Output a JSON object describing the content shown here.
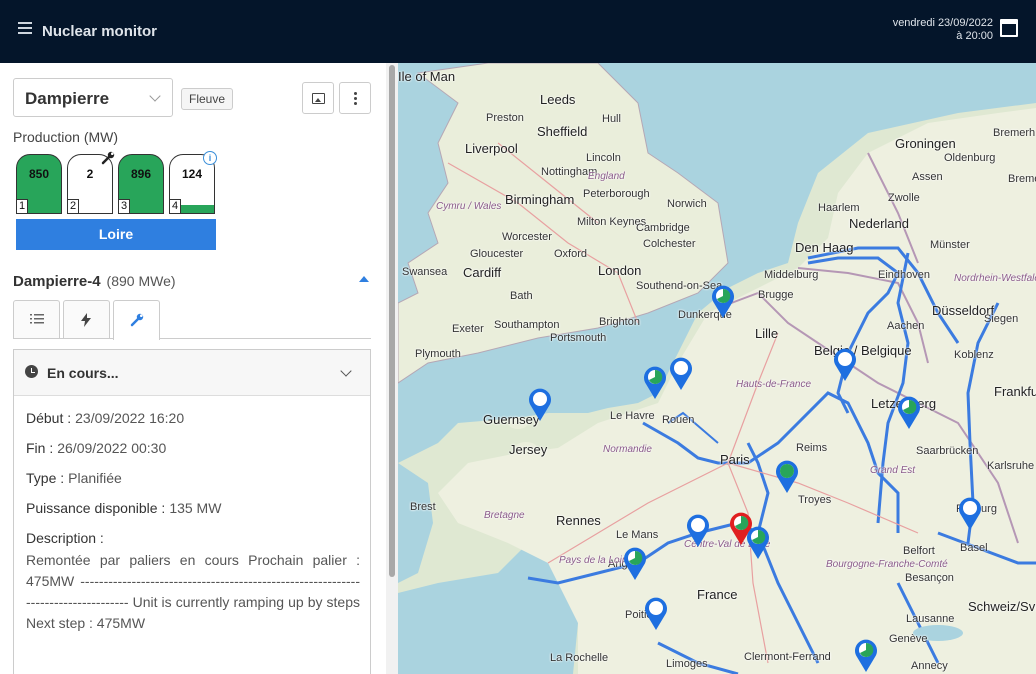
{
  "header": {
    "title": "Nuclear monitor",
    "date_line": "vendredi 23/09/2022",
    "time_line": "à 20:00"
  },
  "plant_selector": {
    "value": "Dampierre"
  },
  "plant_tag": "Fleuve",
  "production": {
    "label": "Production (MW)",
    "units": [
      {
        "number": "1",
        "value": "850",
        "fill_fraction": 1.0,
        "status": "running"
      },
      {
        "number": "2",
        "value": "2",
        "fill_fraction": 0.0,
        "status": "maintenance"
      },
      {
        "number": "3",
        "value": "896",
        "fill_fraction": 1.0,
        "status": "running"
      },
      {
        "number": "4",
        "value": "124",
        "fill_fraction": 0.14,
        "status": "info"
      }
    ],
    "river_button": "Loire"
  },
  "unit_detail": {
    "name": "Dampierre-4",
    "capacity": "(890 MWe)",
    "tabs": [
      "list",
      "power",
      "maintenance"
    ],
    "active_tab": "maintenance"
  },
  "event_card": {
    "title": "En cours...",
    "start_label": "Début :",
    "start_value": "23/09/2022 16:20",
    "end_label": "Fin :",
    "end_value": "26/09/2022 00:30",
    "type_label": "Type :",
    "type_value": "Planifiée",
    "power_label": "Puissance disponible :",
    "power_value": "135 MW",
    "description_label": "Description :",
    "description": "Remontée par paliers en cours Prochain palier : 475MW ---------------------------------------------------------------------------------- Unit is currently ramping up by steps Next step : 475MW"
  },
  "map": {
    "cities": [
      "Leeds",
      "Preston",
      "Hull",
      "Sheffield",
      "Liverpool",
      "Lincoln",
      "Nottingham",
      "England",
      "Peterborough",
      "Cymru / Wales",
      "Birmingham",
      "Norwich",
      "Milton Keynes",
      "Cambridge",
      "Worcester",
      "Colchester",
      "Gloucester",
      "Oxford",
      "Swansea",
      "Cardiff",
      "London",
      "Southend-on-Sea",
      "Bath",
      "Exeter",
      "Southampton",
      "Brighton",
      "Portsmouth",
      "Plymouth",
      "Dunkerque",
      "Lille",
      "Brugge",
      "Middelburg",
      "Den Haag",
      "Haarlem",
      "Nederland",
      "Groningen",
      "Oldenburg",
      "Assen",
      "Zwolle",
      "Münster",
      "Eindhoven",
      "Düsseldorf",
      "Aachen",
      "Siegen",
      "Koblenz",
      "Nordrhein-Westfalen",
      "Belgie / Belgique",
      "Letzebuerg",
      "Frankfurt",
      "Saarbrücken",
      "Karlsruhe",
      "Le Havre",
      "Rouen",
      "Paris",
      "Reims",
      "Hauts-de-France",
      "Guernsey",
      "Jersey",
      "Normandie",
      "Brest",
      "Bretagne",
      "Rennes",
      "Le Mans",
      "Angers",
      "Pays de la Loire",
      "Troyes",
      "Grand Est",
      "Centre-Val de Loire",
      "France",
      "Bourgogne-Franche-Comté",
      "Poitiers",
      "La Rochelle",
      "Limoges",
      "Clermont-Ferrand",
      "Lausanne",
      "Genève",
      "Annecy",
      "Belfort",
      "Besançon",
      "Basel",
      "Freiburg",
      "Schweiz/Svizz",
      "Bremen",
      "Bremerh",
      "Ile of Man"
    ],
    "markers": [
      {
        "name": "Gravelines",
        "status": "partial"
      },
      {
        "name": "Paluel",
        "status": "partial"
      },
      {
        "name": "Penly",
        "status": "offline"
      },
      {
        "name": "Flamanville",
        "status": "offline"
      },
      {
        "name": "Chooz",
        "status": "offline"
      },
      {
        "name": "Cattenom",
        "status": "partial"
      },
      {
        "name": "Nogent",
        "status": "running"
      },
      {
        "name": "Fessenheim",
        "status": "offline"
      },
      {
        "name": "Saint-Laurent",
        "status": "offline"
      },
      {
        "name": "Dampierre",
        "status": "selected"
      },
      {
        "name": "Belleville",
        "status": "partial"
      },
      {
        "name": "Chinon",
        "status": "partial"
      },
      {
        "name": "Civaux",
        "status": "offline"
      },
      {
        "name": "Bugey",
        "status": "partial"
      }
    ]
  }
}
